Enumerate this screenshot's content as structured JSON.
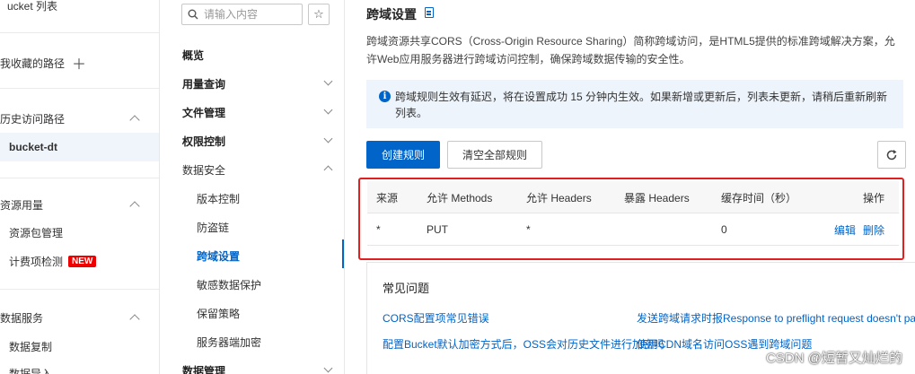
{
  "sidebar": {
    "items": [
      {
        "label": "ucket 列表"
      },
      {
        "label": "我收藏的路径"
      },
      {
        "label": "历史访问路径"
      },
      {
        "label": "bucket-dt"
      },
      {
        "label": "资源用量"
      },
      {
        "label": "资源包管理"
      },
      {
        "label": "计费项检测"
      },
      {
        "label": "数据服务"
      },
      {
        "label": "数据复制"
      },
      {
        "label": "数据导入"
      }
    ],
    "new_badge": "NEW"
  },
  "nav": {
    "search_placeholder": "请输入内容",
    "items": [
      {
        "label": "概览"
      },
      {
        "label": "用量查询"
      },
      {
        "label": "文件管理"
      },
      {
        "label": "权限控制"
      },
      {
        "label": "数据安全"
      },
      {
        "label": "版本控制"
      },
      {
        "label": "防盗链"
      },
      {
        "label": "跨域设置"
      },
      {
        "label": "敏感数据保护"
      },
      {
        "label": "保留策略"
      },
      {
        "label": "服务器端加密"
      },
      {
        "label": "数据管理"
      }
    ]
  },
  "main": {
    "title": "跨域设置",
    "description": "跨域资源共享CORS（Cross-Origin Resource Sharing）简称跨域访问，是HTML5提供的标准跨域解决方案，允许Web应用服务器进行跨域访问控制，确保跨域数据传输的安全性。",
    "notice": "跨域规则生效有延迟，将在设置成功 15 分钟内生效。如果新增或更新后，列表未更新，请稍后重新刷新列表。",
    "create_button": "创建规则",
    "clear_button": "清空全部规则",
    "table": {
      "headers": [
        "来源",
        "允许 Methods",
        "允许 Headers",
        "暴露 Headers",
        "缓存时间（秒）",
        "操作"
      ],
      "rows": [
        {
          "origin": "*",
          "methods": "PUT",
          "allow_headers": "*",
          "expose_headers": "",
          "max_age": "0",
          "edit": "编辑",
          "delete": "删除"
        }
      ]
    },
    "faq": {
      "title": "常见问题",
      "links": [
        "CORS配置项常见错误",
        "发送跨域请求时报Response to preflight request doesn't pa",
        "配置Bucket默认加密方式后，OSS会对历史文件进行加密吗",
        "使用CDN域名访问OSS遇到跨域问题"
      ]
    }
  },
  "watermark": "CSDN @短暂又灿烂的",
  "colors": {
    "accent": "#0064c8",
    "highlight_border": "#e02020",
    "badge": "#ee0000"
  }
}
